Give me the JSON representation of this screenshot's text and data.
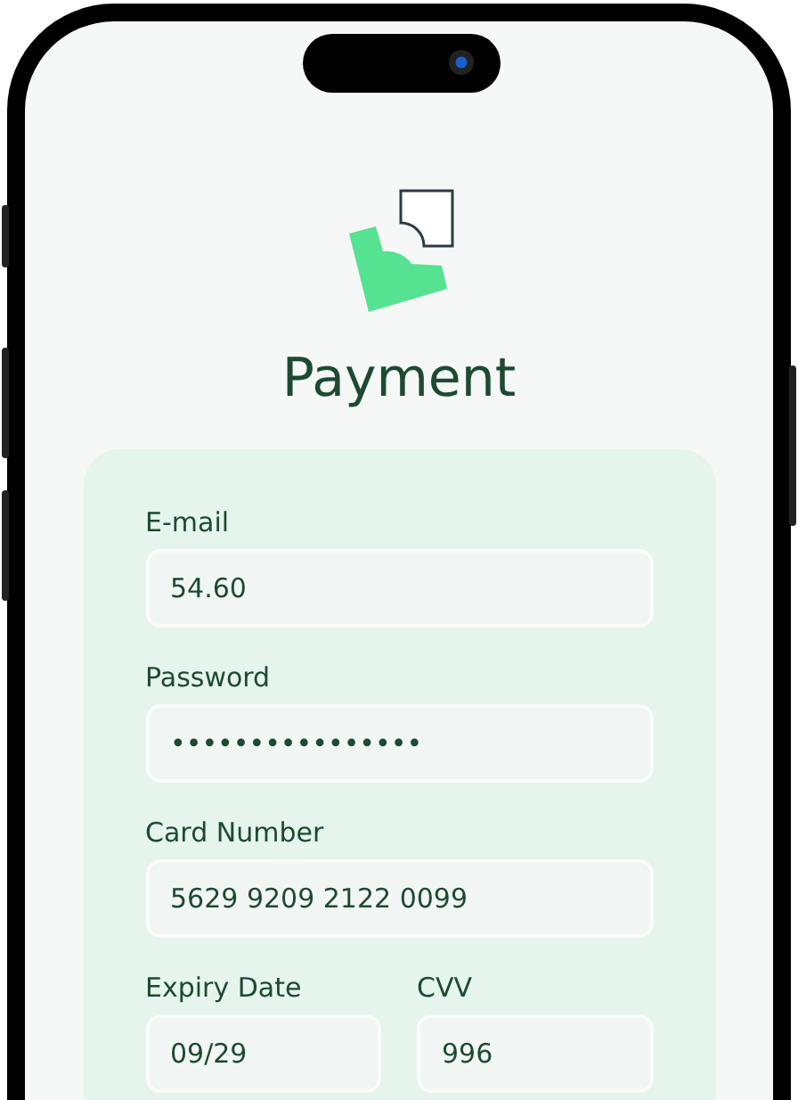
{
  "title": "Payment",
  "fields": [
    {
      "label": "E-mail",
      "value": "54.60",
      "kind": "full"
    },
    {
      "label": "Password",
      "value": "••••••••••••••••",
      "kind": "full"
    },
    {
      "label": "Card Number",
      "value": "5629 9209 2122 0099",
      "kind": "full"
    },
    {
      "label": "Expiry Date",
      "value": "09/29",
      "kind": "half"
    },
    {
      "label": "CVV",
      "value": "996",
      "kind": "half"
    }
  ]
}
